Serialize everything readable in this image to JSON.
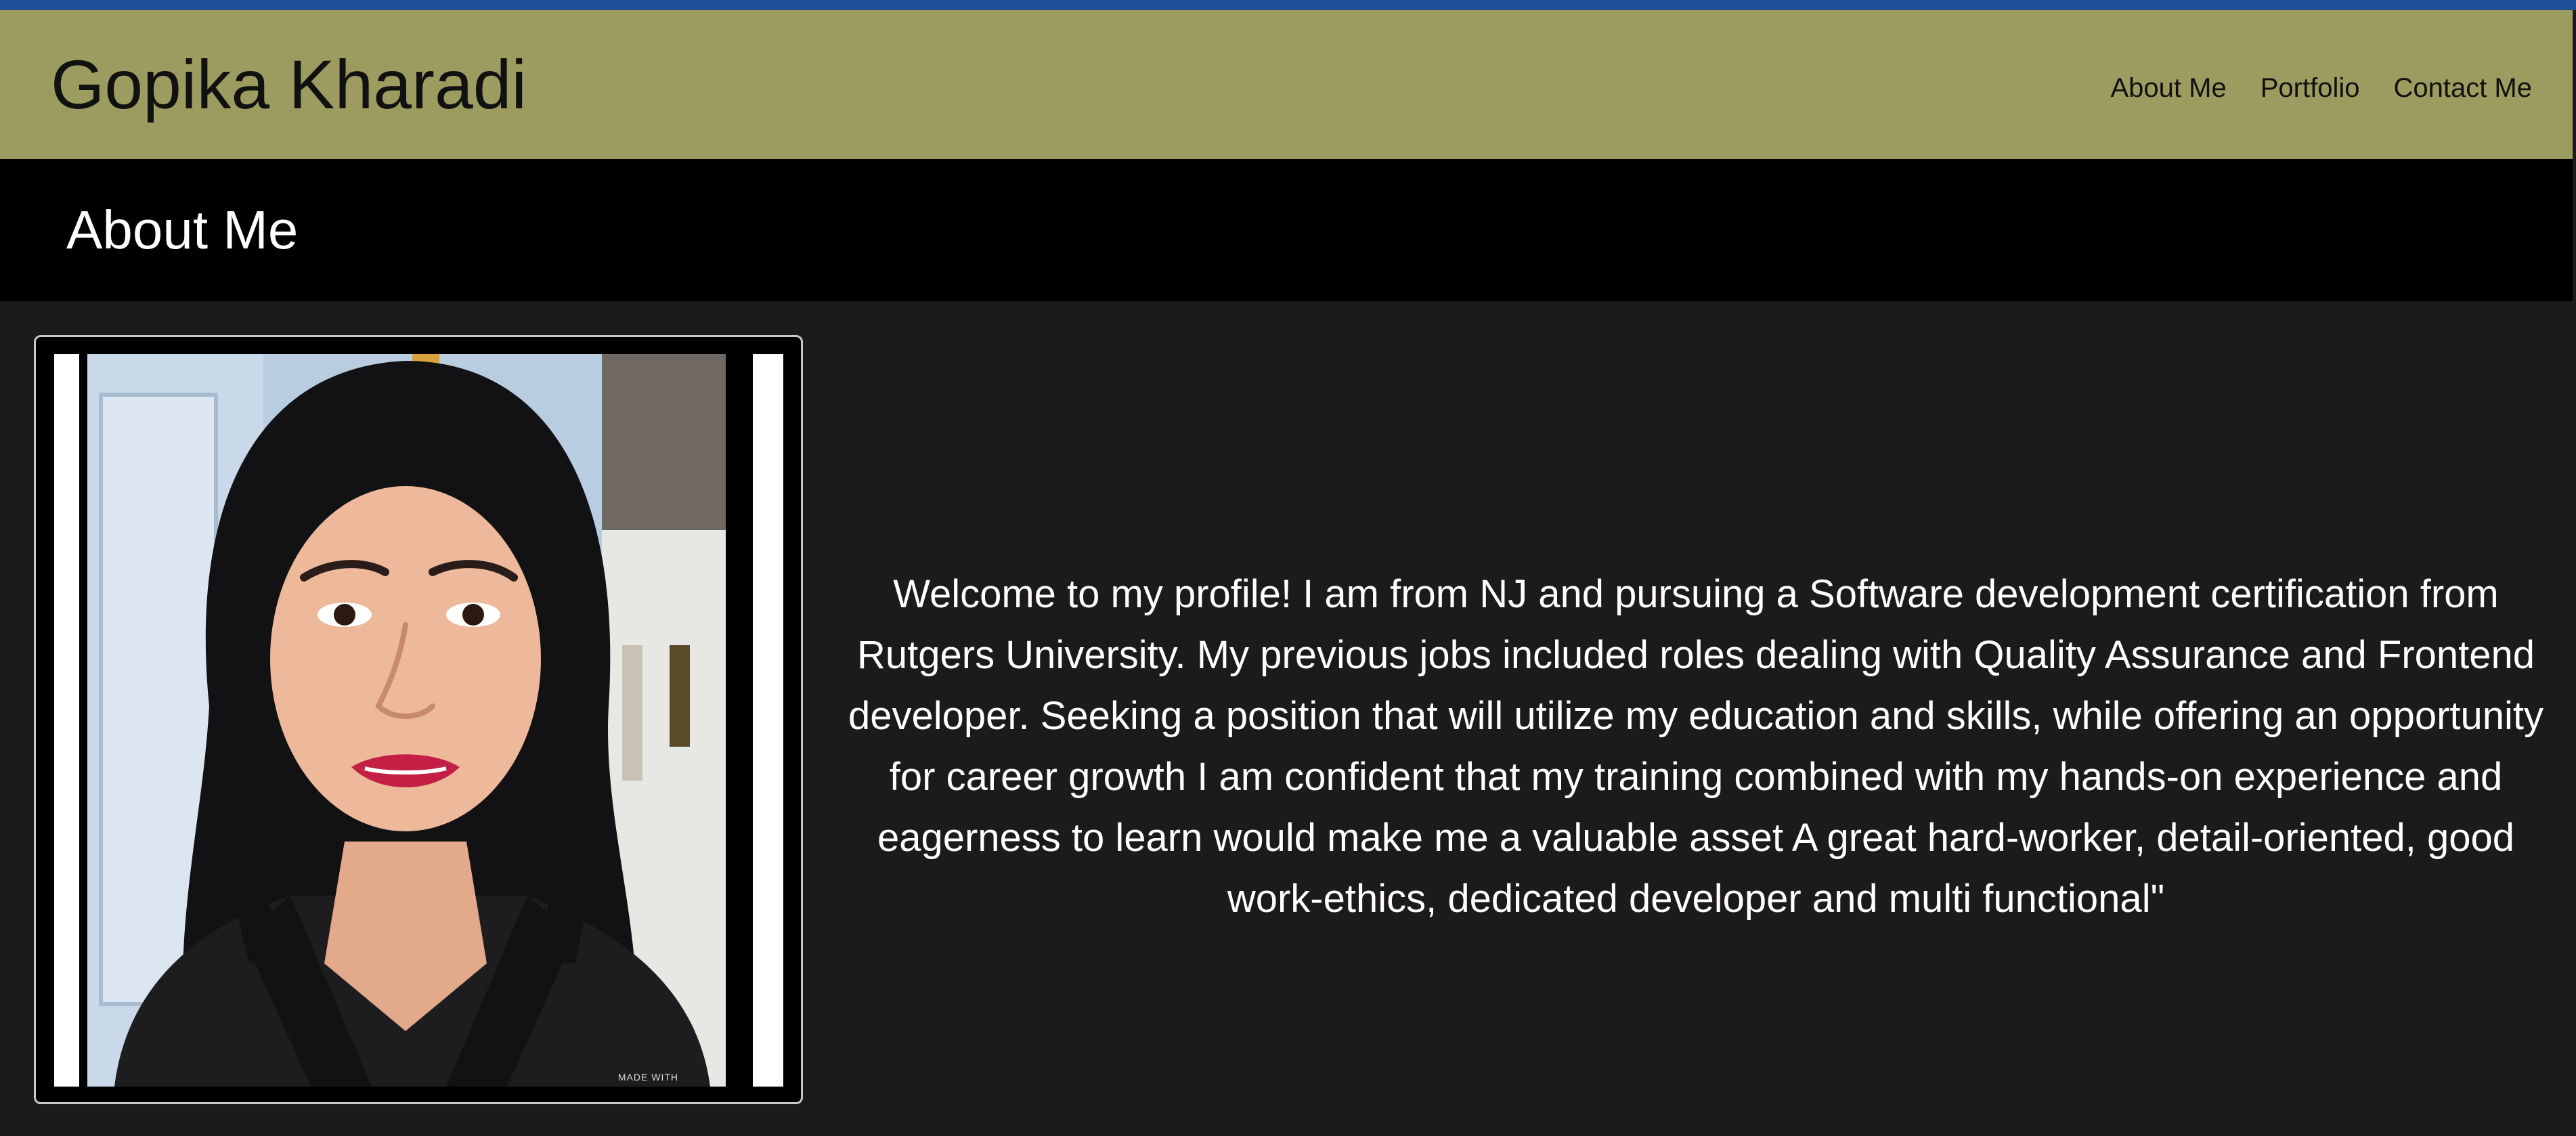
{
  "header": {
    "site_title": "Gopika Kharadi",
    "nav": [
      {
        "label": "About Me"
      },
      {
        "label": "Portfolio"
      },
      {
        "label": "Contact Me"
      }
    ]
  },
  "section": {
    "title": "About Me"
  },
  "profile": {
    "photo_caption": "MADE WITH",
    "bio": "Welcome to my profile! I am from NJ and pursuing a Software development certification from Rutgers University. My previous jobs included roles dealing with Quality Assurance and Frontend developer. Seeking a position that will utilize my education and skills, while offering an opportunity for career growth I am confident that my training combined with my hands-on experience and eagerness to learn would make me a valuable asset A great hard-worker, detail-oriented, good work-ethics, dedicated developer and multi functional\""
  },
  "colors": {
    "top_stripe": "#1f4f96",
    "header_bg": "#9d9c60",
    "section_bar_bg": "#000000",
    "page_bg": "#1c1a1b"
  }
}
